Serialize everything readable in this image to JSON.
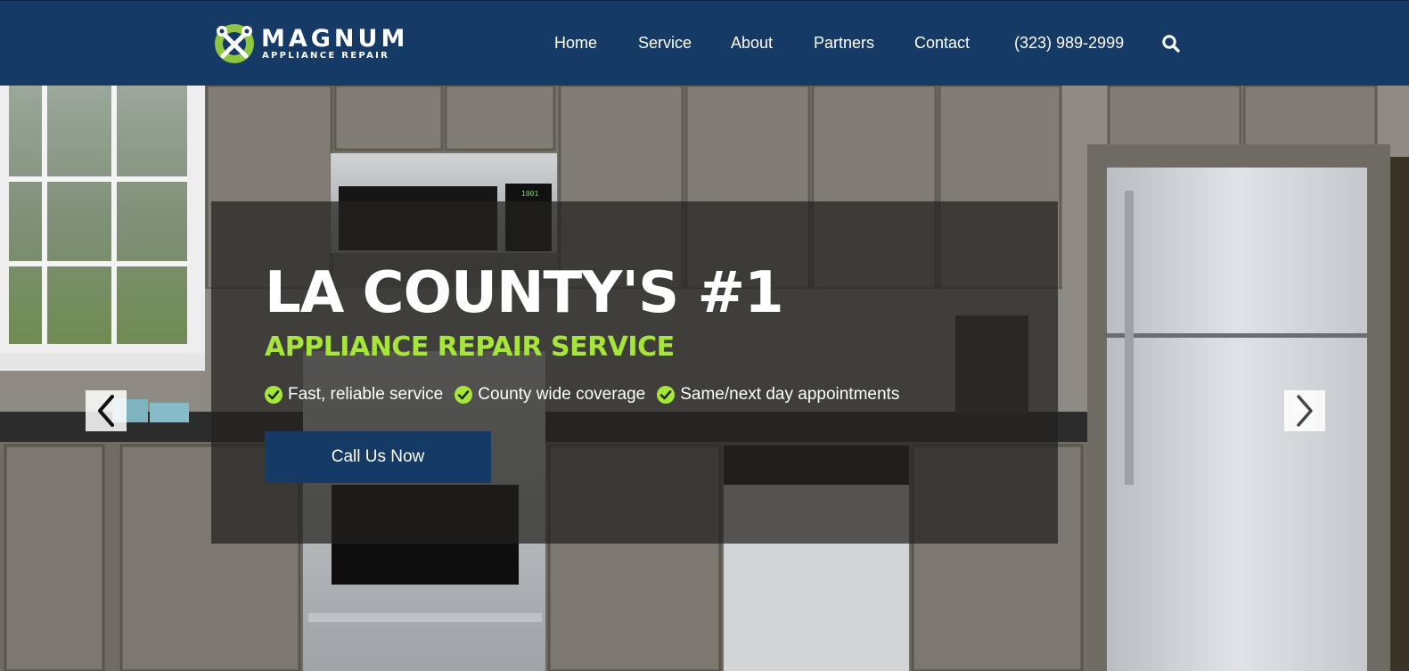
{
  "brand": {
    "name": "MAGNUM",
    "tagline": "APPLIANCE REPAIR",
    "accent_color": "#a6e63a",
    "navy_color": "#153a66"
  },
  "nav": {
    "items": [
      {
        "label": "Home"
      },
      {
        "label": "Service"
      },
      {
        "label": "About"
      },
      {
        "label": "Partners"
      },
      {
        "label": "Contact"
      }
    ],
    "phone": "(323) 989-2999",
    "search_icon": "search-icon"
  },
  "hero": {
    "headline": "LA COUNTY'S #1",
    "subheadline": "APPLIANCE REPAIR SERVICE",
    "features": [
      {
        "text": "Fast, reliable service",
        "icon": "check-circle-icon"
      },
      {
        "text": "County wide coverage",
        "icon": "check-circle-icon"
      },
      {
        "text": "Same/next day appointments",
        "icon": "check-circle-icon"
      }
    ],
    "cta_label": "Call Us Now",
    "prev_icon": "chevron-left-icon",
    "next_icon": "chevron-right-icon",
    "microwave_clock": "1001"
  }
}
